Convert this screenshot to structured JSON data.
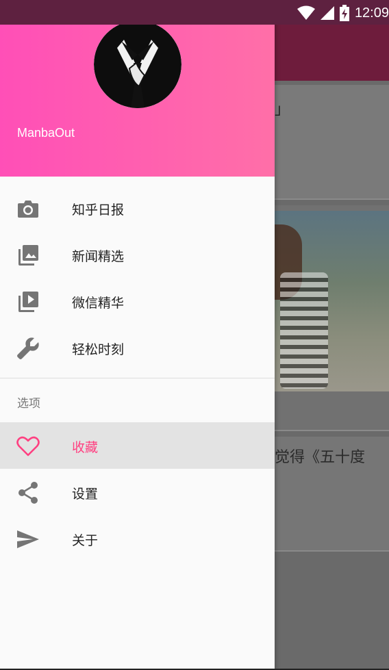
{
  "status_bar": {
    "time": "12:09",
    "icons": [
      "wifi-icon",
      "signal-icon",
      "battery-charging-icon"
    ]
  },
  "background_content": {
    "card1_bracket": "」",
    "card3_title": "觉得《五十度"
  },
  "drawer": {
    "username": "ManbaOut",
    "primary_items": [
      {
        "icon": "camera-icon",
        "label": "知乎日报"
      },
      {
        "icon": "photo-library-icon",
        "label": "新闻精选"
      },
      {
        "icon": "video-library-icon",
        "label": "微信精华"
      },
      {
        "icon": "wrench-icon",
        "label": "轻松时刻"
      }
    ],
    "section_title": "选项",
    "option_items": [
      {
        "icon": "heart-icon",
        "label": "收藏",
        "selected": true
      },
      {
        "icon": "share-icon",
        "label": "设置"
      },
      {
        "icon": "send-icon",
        "label": "关于"
      }
    ]
  },
  "colors": {
    "accent": "#ff4081",
    "header_gradient_start": "#ff4fb7",
    "header_gradient_end": "#ff6fa8",
    "icon_gray": "#757575"
  }
}
